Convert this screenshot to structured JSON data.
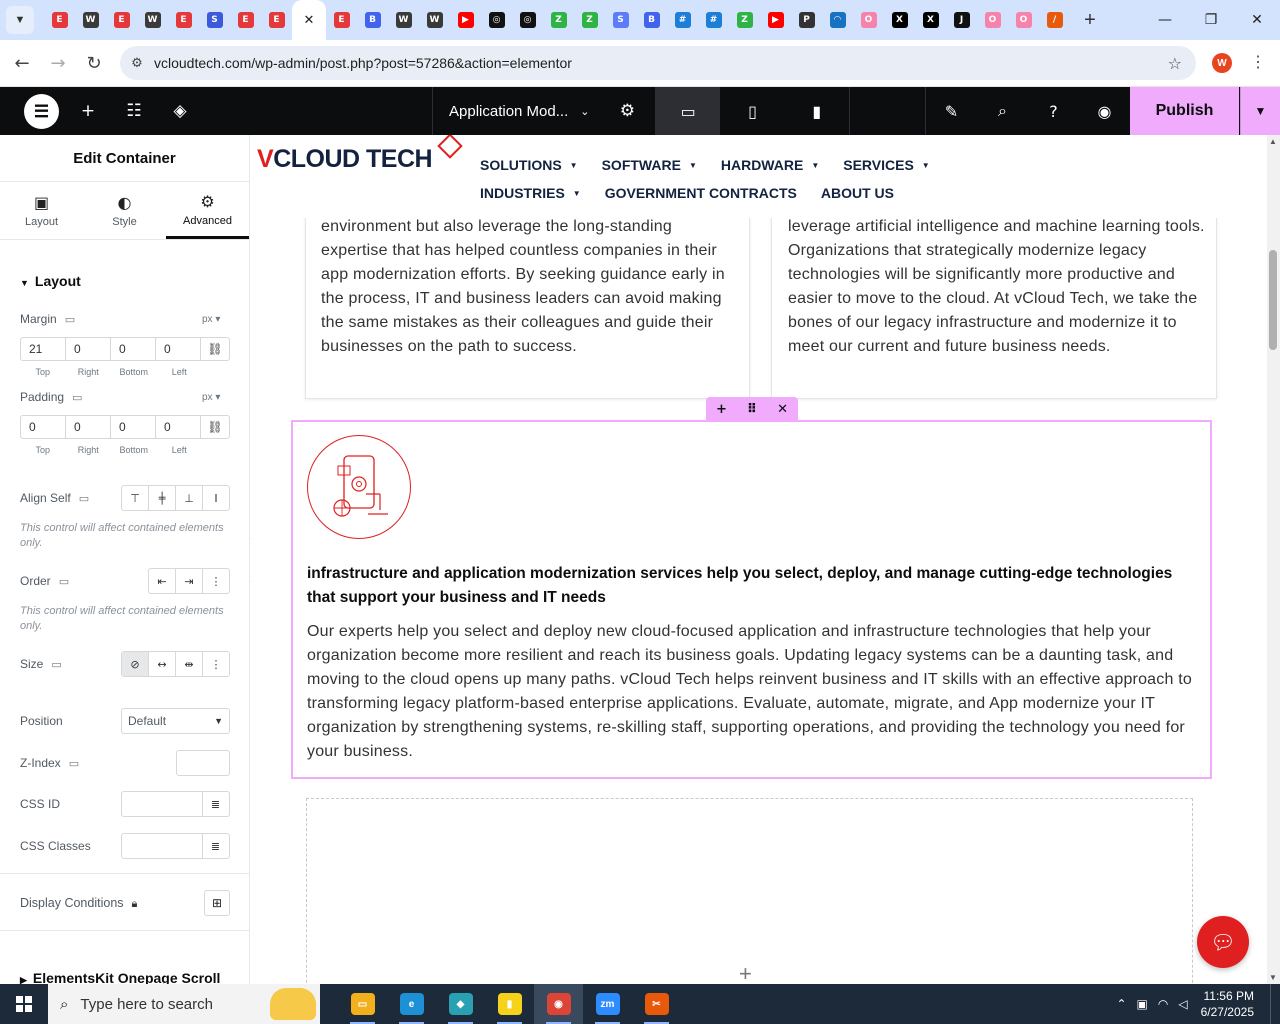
{
  "browser": {
    "tabs": [
      {
        "icon": "elementor-red-icon",
        "color": "#e5383b",
        "glyph": "E"
      },
      {
        "icon": "wordpress-icon",
        "color": "#3a3a3a",
        "glyph": "W"
      },
      {
        "icon": "elementor-red-icon",
        "color": "#e5383b",
        "glyph": "E"
      },
      {
        "icon": "wordpress-icon",
        "color": "#3a3a3a",
        "glyph": "W"
      },
      {
        "icon": "elementor-red-icon",
        "color": "#e5383b",
        "glyph": "E"
      },
      {
        "icon": "blue-swirl-icon",
        "color": "#3b5bdb",
        "glyph": "S"
      },
      {
        "icon": "elementor-red-icon",
        "color": "#e5383b",
        "glyph": "E"
      },
      {
        "icon": "elementor-red-icon",
        "color": "#e5383b",
        "glyph": "E"
      },
      {
        "icon": "elementor-red-icon",
        "color": "#e5383b",
        "glyph": "E",
        "active": true
      },
      {
        "icon": "elementor-red-icon",
        "color": "#e5383b",
        "glyph": "E"
      },
      {
        "icon": "blue-chart-icon",
        "color": "#4263eb",
        "glyph": "B"
      },
      {
        "icon": "wordpress-icon",
        "color": "#3a3a3a",
        "glyph": "W"
      },
      {
        "icon": "wordpress-icon",
        "color": "#3a3a3a",
        "glyph": "W"
      },
      {
        "icon": "youtube-icon",
        "color": "#ff0000",
        "glyph": "▶"
      },
      {
        "icon": "openai-icon",
        "color": "#111111",
        "glyph": "◎"
      },
      {
        "icon": "openai-icon",
        "color": "#111111",
        "glyph": "◎"
      },
      {
        "icon": "green-bolt-icon",
        "color": "#2fb344",
        "glyph": "Z"
      },
      {
        "icon": "green-bolt-icon",
        "color": "#2fb344",
        "glyph": "Z"
      },
      {
        "icon": "blue-swirl-icon",
        "color": "#5c7cfa",
        "glyph": "S"
      },
      {
        "icon": "blue-chart-icon",
        "color": "#4263eb",
        "glyph": "B"
      },
      {
        "icon": "blue-grid-icon",
        "color": "#1c7ed6",
        "glyph": "#"
      },
      {
        "icon": "blue-grid-icon",
        "color": "#1c7ed6",
        "glyph": "#"
      },
      {
        "icon": "green-bolt-icon",
        "color": "#2fb344",
        "glyph": "Z"
      },
      {
        "icon": "youtube-icon",
        "color": "#ff0000",
        "glyph": "▶"
      },
      {
        "icon": "lock-person-icon",
        "color": "#333333",
        "glyph": "P"
      },
      {
        "icon": "arc-icon",
        "color": "#1971c2",
        "glyph": "◠"
      },
      {
        "icon": "ring-icon",
        "color": "#f783ac",
        "glyph": "O"
      },
      {
        "icon": "x-icon",
        "color": "#000000",
        "glyph": "X"
      },
      {
        "icon": "x-icon",
        "color": "#000000",
        "glyph": "X"
      },
      {
        "icon": "dark-square-icon",
        "color": "#111111",
        "glyph": "J"
      },
      {
        "icon": "ring-icon",
        "color": "#f783ac",
        "glyph": "O"
      },
      {
        "icon": "ring-icon",
        "color": "#f783ac",
        "glyph": "O"
      },
      {
        "icon": "slash-icon",
        "color": "#e8590c",
        "glyph": "/"
      }
    ],
    "url": "vcloudtech.com/wp-admin/post.php?post=57286&action=elementor",
    "profile_initial": "W"
  },
  "editor": {
    "page_title": "Application Mod...",
    "publish_label": "Publish"
  },
  "panel": {
    "title": "Edit Container",
    "tabs": [
      {
        "label": "Layout",
        "icon": "layout-icon"
      },
      {
        "label": "Style",
        "icon": "style-icon"
      },
      {
        "label": "Advanced",
        "icon": "gear-icon",
        "active": true
      }
    ],
    "section": "Layout",
    "margin": {
      "label": "Margin",
      "unit": "px",
      "top": "21",
      "right": "0",
      "bottom": "0",
      "left": "0"
    },
    "padding": {
      "label": "Padding",
      "unit": "px",
      "top": "0",
      "right": "0",
      "bottom": "0",
      "left": "0"
    },
    "dim_labels": {
      "top": "Top",
      "right": "Right",
      "bottom": "Bottom",
      "left": "Left"
    },
    "align_self": "Align Self",
    "contained_note": "This control will affect contained elements only.",
    "order": "Order",
    "size": "Size",
    "position": {
      "label": "Position",
      "value": "Default"
    },
    "z_index": "Z-Index",
    "css_id": "CSS ID",
    "css_classes": "CSS Classes",
    "display_conditions": "Display Conditions",
    "next_section": "ElementsKit Onepage Scroll"
  },
  "site": {
    "logo_v": "V",
    "logo_rest": "CLOUD TECH",
    "menu": [
      {
        "label": "SOLUTIONS",
        "dropdown": true
      },
      {
        "label": "SOFTWARE",
        "dropdown": true
      },
      {
        "label": "HARDWARE",
        "dropdown": true
      },
      {
        "label": "SERVICES",
        "dropdown": true
      },
      {
        "label": "INDUSTRIES",
        "dropdown": true
      },
      {
        "label": "GOVERNMENT CONTRACTS",
        "dropdown": false
      },
      {
        "label": "ABOUT US",
        "dropdown": false
      }
    ],
    "left_col_text": "environment but also leverage the long-standing expertise that has helped countless companies in their app modernization efforts. By seeking guidance early in the process, IT and business leaders can avoid making the same mistakes as their colleagues and guide their businesses on the path to success.",
    "right_col_text": "leverage artificial intelligence and machine learning tools. Organizations that strategically modernize legacy technologies will be significantly more productive and easier to move to the cloud. At vCloud Tech, we take the bones of our legacy infrastructure and modernize it to meet our current and future business needs.",
    "feature_title": "infrastructure and application modernization services help you select, deploy, and manage cutting-edge technologies that support your business and IT needs",
    "feature_body": "Our experts help you select and deploy new cloud-focused application and infrastructure technologies that help your organization become more resilient and reach its business goals. Updating legacy systems can be a daunting task, and moving to the cloud opens up many paths. vCloud Tech helps reinvent business and IT skills with an effective approach to transforming legacy platform-based enterprise applications. Evaluate, automate, migrate, and App modernize your IT organization by strengthening systems, re-skilling staff, supporting operations, and providing the technology you need for your business.",
    "accent": "#e02020"
  },
  "taskbar": {
    "search_placeholder": "Type here to search",
    "apps": [
      {
        "icon": "file-explorer-icon",
        "color": "#f2b01e",
        "glyph": "▭"
      },
      {
        "icon": "edge-icon",
        "color": "#1e90d6",
        "glyph": "e"
      },
      {
        "icon": "app-hex-icon",
        "color": "#2aa1b3",
        "glyph": "◆"
      },
      {
        "icon": "sticky-notes-icon",
        "color": "#f7d21b",
        "glyph": "▮"
      },
      {
        "icon": "chrome-icon",
        "color": "#db4437",
        "glyph": "◉",
        "active": true
      },
      {
        "icon": "zoom-icon",
        "color": "#2d8cff",
        "glyph": "zm"
      },
      {
        "icon": "snipping-tool-icon",
        "color": "#e8590c",
        "glyph": "✂"
      }
    ],
    "time": "11:56 PM",
    "date": "6/27/2025"
  }
}
